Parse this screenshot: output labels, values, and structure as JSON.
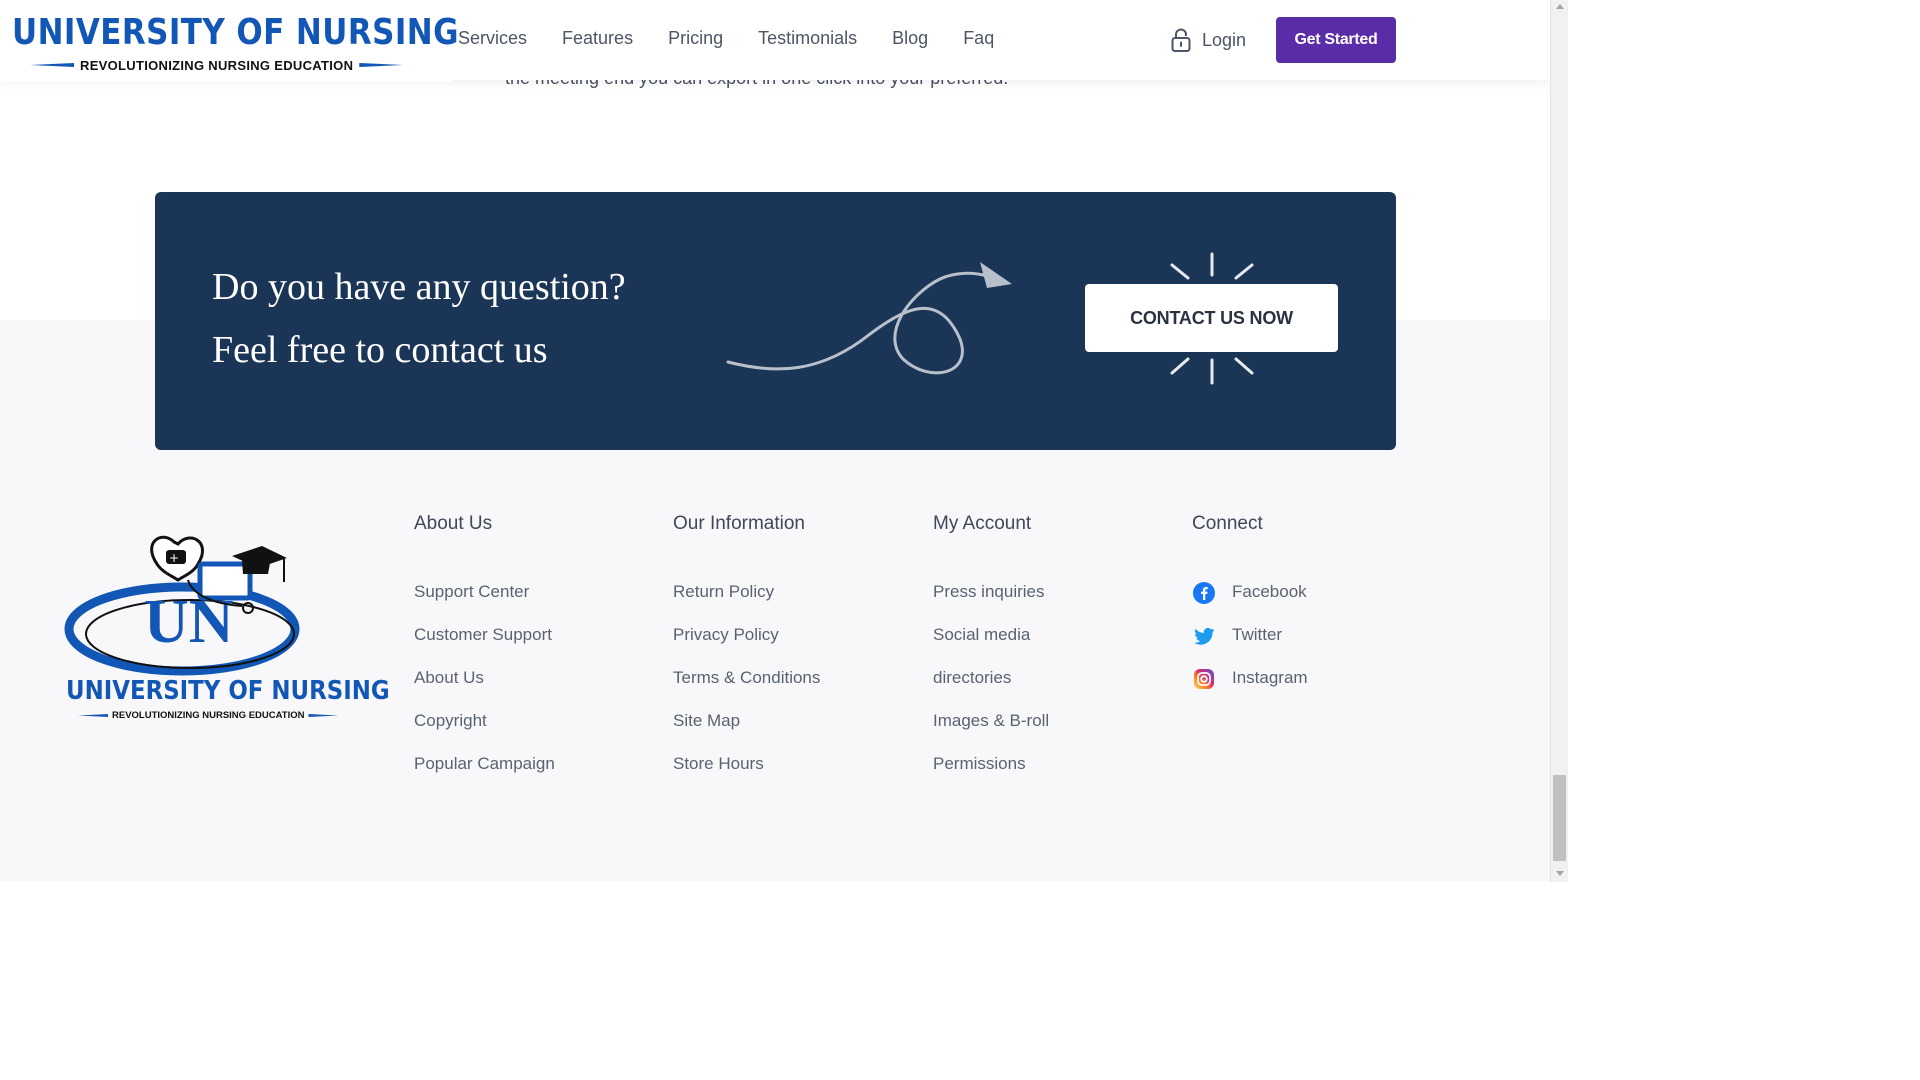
{
  "header": {
    "logo_title": "UNIVERSITY OF NURSING",
    "logo_subtitle": "REVOLUTIONIZING NURSING EDUCATION",
    "nav": [
      "Services",
      "Features",
      "Pricing",
      "Testimonials",
      "Blog",
      "Faq"
    ],
    "login_label": "Login",
    "cta_label": "Get Started",
    "accent_color": "#5b2ca8",
    "brand_color": "#1257b5"
  },
  "peek_text": "the meeting end you can export in one click into your preferred.",
  "cta": {
    "line1": "Do you have any question?",
    "line2": "Feel free to contact us",
    "button_label": "CONTACT US NOW",
    "bg_color": "#1b3556"
  },
  "footer": {
    "logo_title": "UNIVERSITY OF NURSING",
    "logo_subtitle": "REVOLUTIONIZING NURSING EDUCATION",
    "columns": [
      {
        "heading": "About Us",
        "links": [
          "Support Center",
          "Customer Support",
          "About Us",
          "Copyright",
          "Popular Campaign"
        ]
      },
      {
        "heading": "Our Information",
        "links": [
          "Return Policy",
          "Privacy Policy",
          "Terms & Conditions",
          "Site Map",
          "Store Hours"
        ]
      },
      {
        "heading": "My Account",
        "links": [
          "Press inquiries",
          "Social media",
          "directories",
          "Images & B-roll",
          "Permissions"
        ]
      },
      {
        "heading": "Connect",
        "links": [
          "Facebook",
          "Twitter",
          "Instagram"
        ],
        "icons": [
          "facebook-icon",
          "twitter-icon",
          "instagram-icon"
        ]
      }
    ]
  }
}
